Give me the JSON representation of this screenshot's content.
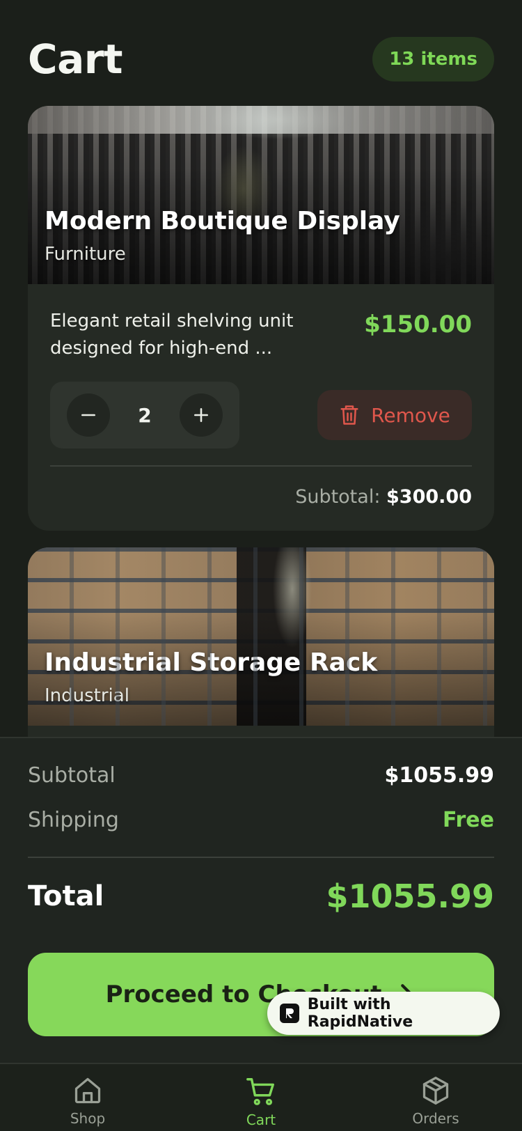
{
  "header": {
    "title": "Cart",
    "item_count": "13 items"
  },
  "items": [
    {
      "name": "Modern Boutique Display",
      "category": "Furniture",
      "description": "Elegant retail shelving unit designed for high-end ...",
      "price": "$150.00",
      "quantity": "2",
      "remove_label": "Remove",
      "subtotal_label": "Subtotal:",
      "subtotal_value": "$300.00"
    },
    {
      "name": "Industrial Storage Rack",
      "category": "Industrial"
    }
  ],
  "summary": {
    "subtotal_label": "Subtotal",
    "subtotal_value": "$1055.99",
    "shipping_label": "Shipping",
    "shipping_value": "Free",
    "total_label": "Total",
    "total_value": "$1055.99",
    "checkout_label": "Proceed to Checkout"
  },
  "badge": {
    "label": "Built with RapidNative"
  },
  "tabs": [
    {
      "label": "Shop",
      "icon": "home-icon"
    },
    {
      "label": "Cart",
      "icon": "cart-icon",
      "active": true
    },
    {
      "label": "Orders",
      "icon": "box-icon"
    }
  ],
  "colors": {
    "accent": "#80d85a",
    "danger": "#e0574c",
    "background": "#1b1f1a"
  }
}
